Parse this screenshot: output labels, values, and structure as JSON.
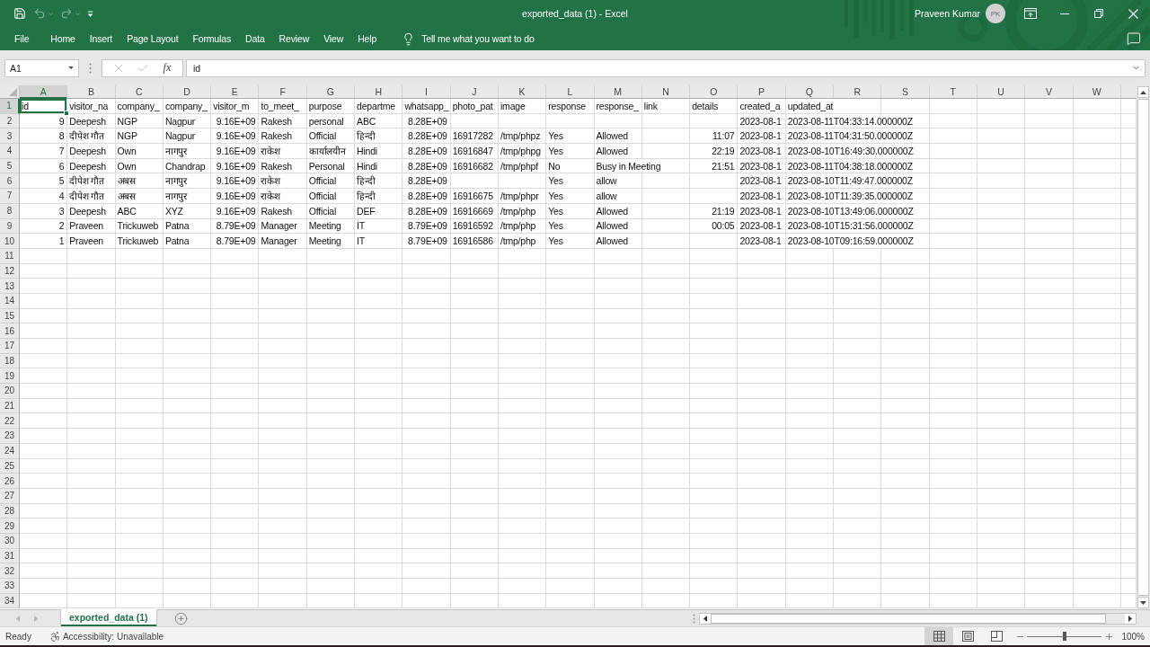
{
  "window": {
    "title": "exported_data (1) - Excel",
    "user_name": "Praveen Kumar",
    "avatar_initials": "PK"
  },
  "quick_access": [
    {
      "kind": "save",
      "disabled": false
    },
    {
      "kind": "undo",
      "disabled": true
    },
    {
      "kind": "redo",
      "disabled": true
    }
  ],
  "ribbon_tabs": [
    "File",
    "Home",
    "Insert",
    "Page Layout",
    "Formulas",
    "Data",
    "Review",
    "View",
    "Help"
  ],
  "tell_me": "Tell me what you want to do",
  "formula_bar": {
    "name_box": "A1",
    "function_button": "fx",
    "value": "id",
    "edit_buttons_disabled": true
  },
  "sheet": {
    "columns": [
      {
        "letter": "A",
        "selected": true
      },
      {
        "letter": "B",
        "selected": false
      },
      {
        "letter": "C",
        "selected": false
      },
      {
        "letter": "D",
        "selected": false
      },
      {
        "letter": "E",
        "selected": false
      },
      {
        "letter": "F",
        "selected": false
      },
      {
        "letter": "G",
        "selected": false
      },
      {
        "letter": "H",
        "selected": false
      },
      {
        "letter": "I",
        "selected": false
      },
      {
        "letter": "J",
        "selected": false
      },
      {
        "letter": "K",
        "selected": false
      },
      {
        "letter": "L",
        "selected": false
      },
      {
        "letter": "M",
        "selected": false
      },
      {
        "letter": "N",
        "selected": false
      },
      {
        "letter": "O",
        "selected": false
      },
      {
        "letter": "P",
        "selected": false
      },
      {
        "letter": "Q",
        "selected": false
      },
      {
        "letter": "R",
        "selected": false
      },
      {
        "letter": "S",
        "selected": false
      },
      {
        "letter": "T",
        "selected": false
      },
      {
        "letter": "U",
        "selected": false
      },
      {
        "letter": "V",
        "selected": false
      },
      {
        "letter": "W",
        "selected": false
      }
    ],
    "rows": [
      {
        "number": "1",
        "selected": true,
        "cells": [
          {
            "kind": "text",
            "text": "id"
          },
          {
            "kind": "text",
            "text": "visitor_na"
          },
          {
            "kind": "text",
            "text": "company_"
          },
          {
            "kind": "text",
            "text": "company_"
          },
          {
            "kind": "text",
            "text": "visitor_m"
          },
          {
            "kind": "text",
            "text": "to_meet_"
          },
          {
            "kind": "text",
            "text": "purpose"
          },
          {
            "kind": "text",
            "text": "departme"
          },
          {
            "kind": "text",
            "text": "whatsapp_"
          },
          {
            "kind": "text",
            "text": "photo_pat"
          },
          {
            "kind": "text",
            "text": "image"
          },
          {
            "kind": "text",
            "text": "response"
          },
          {
            "kind": "text",
            "text": "response_"
          },
          {
            "kind": "text",
            "text": "link"
          },
          {
            "kind": "text",
            "text": "details"
          },
          {
            "kind": "text",
            "text": "created_a"
          },
          {
            "kind": "text",
            "text": "updated_at"
          }
        ]
      },
      {
        "number": "2",
        "selected": false,
        "cells": [
          {
            "kind": "number",
            "text": "9"
          },
          {
            "kind": "text",
            "text": "Deepesh"
          },
          {
            "kind": "text",
            "text": "NGP"
          },
          {
            "kind": "text",
            "text": "Nagpur"
          },
          {
            "kind": "number",
            "text": "9.16E+09"
          },
          {
            "kind": "text",
            "text": "Rakesh"
          },
          {
            "kind": "text",
            "text": "personal"
          },
          {
            "kind": "text",
            "text": "ABC"
          },
          {
            "kind": "number",
            "text": "8.28E+09"
          },
          {
            "kind": "empty"
          },
          {
            "kind": "empty"
          },
          {
            "kind": "empty"
          },
          {
            "kind": "empty"
          },
          {
            "kind": "empty"
          },
          {
            "kind": "empty"
          },
          {
            "kind": "text",
            "text": "2023-08-1"
          },
          {
            "kind": "text",
            "text": "2023-08-11T04:33:14.000000Z"
          }
        ]
      },
      {
        "number": "3",
        "selected": false,
        "cells": [
          {
            "kind": "number",
            "text": "8"
          },
          {
            "kind": "text",
            "text": "दीपेश गौत"
          },
          {
            "kind": "text",
            "text": "NGP"
          },
          {
            "kind": "text",
            "text": "Nagpur"
          },
          {
            "kind": "number",
            "text": "9.16E+09"
          },
          {
            "kind": "text",
            "text": "Rakesh"
          },
          {
            "kind": "text",
            "text": "Official"
          },
          {
            "kind": "text",
            "text": "हिन्दी"
          },
          {
            "kind": "number",
            "text": "8.28E+09"
          },
          {
            "kind": "text",
            "text": "16917282"
          },
          {
            "kind": "text",
            "text": "/tmp/phpz"
          },
          {
            "kind": "text",
            "text": "Yes"
          },
          {
            "kind": "text",
            "text": "Allowed"
          },
          {
            "kind": "empty"
          },
          {
            "kind": "number",
            "text": "11:07"
          },
          {
            "kind": "text",
            "text": "2023-08-1"
          },
          {
            "kind": "text",
            "text": "2023-08-11T04:31:50.000000Z"
          }
        ]
      },
      {
        "number": "4",
        "selected": false,
        "cells": [
          {
            "kind": "number",
            "text": "7"
          },
          {
            "kind": "text",
            "text": "Deepesh"
          },
          {
            "kind": "text",
            "text": "Own"
          },
          {
            "kind": "text",
            "text": "नागपुर"
          },
          {
            "kind": "number",
            "text": "9.16E+09"
          },
          {
            "kind": "text",
            "text": "राकेश"
          },
          {
            "kind": "text",
            "text": "कार्यालयीन"
          },
          {
            "kind": "text",
            "text": "Hindi"
          },
          {
            "kind": "number",
            "text": "8.28E+09"
          },
          {
            "kind": "text",
            "text": "16916847"
          },
          {
            "kind": "text",
            "text": "/tmp/phpg"
          },
          {
            "kind": "text",
            "text": "Yes"
          },
          {
            "kind": "text",
            "text": "Allowed"
          },
          {
            "kind": "empty"
          },
          {
            "kind": "number",
            "text": "22:19"
          },
          {
            "kind": "text",
            "text": "2023-08-1"
          },
          {
            "kind": "text",
            "text": "2023-08-10T16:49:30.000000Z"
          }
        ]
      },
      {
        "number": "5",
        "selected": false,
        "cells": [
          {
            "kind": "number",
            "text": "6"
          },
          {
            "kind": "text",
            "text": "Deepesh"
          },
          {
            "kind": "text",
            "text": "Own"
          },
          {
            "kind": "text",
            "text": "Chandrap"
          },
          {
            "kind": "number",
            "text": "9.16E+09"
          },
          {
            "kind": "text",
            "text": "Rakesh"
          },
          {
            "kind": "text",
            "text": "Personal"
          },
          {
            "kind": "text",
            "text": "Hindi"
          },
          {
            "kind": "number",
            "text": "8.28E+09"
          },
          {
            "kind": "text",
            "text": "16916682"
          },
          {
            "kind": "text",
            "text": "/tmp/phpf"
          },
          {
            "kind": "text",
            "text": "No"
          },
          {
            "kind": "text",
            "text": "Busy in Meeting"
          },
          {
            "kind": "empty"
          },
          {
            "kind": "number",
            "text": "21:51"
          },
          {
            "kind": "text",
            "text": "2023-08-1"
          },
          {
            "kind": "text",
            "text": "2023-08-11T04:38:18.000000Z"
          }
        ]
      },
      {
        "number": "6",
        "selected": false,
        "cells": [
          {
            "kind": "number",
            "text": "5"
          },
          {
            "kind": "text",
            "text": "दीपेश गौत"
          },
          {
            "kind": "text",
            "text": "अबस"
          },
          {
            "kind": "text",
            "text": "नागपुर"
          },
          {
            "kind": "number",
            "text": "9.16E+09"
          },
          {
            "kind": "text",
            "text": "राकेश"
          },
          {
            "kind": "text",
            "text": "Official"
          },
          {
            "kind": "text",
            "text": "हिन्दी"
          },
          {
            "kind": "number",
            "text": "8.28E+09"
          },
          {
            "kind": "empty"
          },
          {
            "kind": "empty"
          },
          {
            "kind": "text",
            "text": "Yes"
          },
          {
            "kind": "text",
            "text": "allow"
          },
          {
            "kind": "empty"
          },
          {
            "kind": "empty"
          },
          {
            "kind": "text",
            "text": "2023-08-1"
          },
          {
            "kind": "text",
            "text": "2023-08-10T11:49:47.000000Z"
          }
        ]
      },
      {
        "number": "7",
        "selected": false,
        "cells": [
          {
            "kind": "number",
            "text": "4"
          },
          {
            "kind": "text",
            "text": "दीपेश गौत"
          },
          {
            "kind": "text",
            "text": "अबस"
          },
          {
            "kind": "text",
            "text": "नागपुर"
          },
          {
            "kind": "number",
            "text": "9.16E+09"
          },
          {
            "kind": "text",
            "text": "राकेश"
          },
          {
            "kind": "text",
            "text": "Official"
          },
          {
            "kind": "text",
            "text": "हिन्दी"
          },
          {
            "kind": "number",
            "text": "8.28E+09"
          },
          {
            "kind": "text",
            "text": "16916675"
          },
          {
            "kind": "text",
            "text": "/tmp/phpr"
          },
          {
            "kind": "text",
            "text": "Yes"
          },
          {
            "kind": "text",
            "text": "allow"
          },
          {
            "kind": "empty"
          },
          {
            "kind": "empty"
          },
          {
            "kind": "text",
            "text": "2023-08-1"
          },
          {
            "kind": "text",
            "text": "2023-08-10T11:39:35.000000Z"
          }
        ]
      },
      {
        "number": "8",
        "selected": false,
        "cells": [
          {
            "kind": "number",
            "text": "3"
          },
          {
            "kind": "text",
            "text": "Deepesh"
          },
          {
            "kind": "text",
            "text": "ABC"
          },
          {
            "kind": "text",
            "text": "XYZ"
          },
          {
            "kind": "number",
            "text": "9.16E+09"
          },
          {
            "kind": "text",
            "text": "Rakesh"
          },
          {
            "kind": "text",
            "text": "Official"
          },
          {
            "kind": "text",
            "text": "DEF"
          },
          {
            "kind": "number",
            "text": "8.28E+09"
          },
          {
            "kind": "text",
            "text": "16916669"
          },
          {
            "kind": "text",
            "text": "/tmp/php"
          },
          {
            "kind": "text",
            "text": "Yes"
          },
          {
            "kind": "text",
            "text": "Allowed"
          },
          {
            "kind": "empty"
          },
          {
            "kind": "number",
            "text": "21:19"
          },
          {
            "kind": "text",
            "text": "2023-08-1"
          },
          {
            "kind": "text",
            "text": "2023-08-10T13:49:06.000000Z"
          }
        ]
      },
      {
        "number": "9",
        "selected": false,
        "cells": [
          {
            "kind": "number",
            "text": "2"
          },
          {
            "kind": "text",
            "text": "Praveen"
          },
          {
            "kind": "text",
            "text": "Trickuweb"
          },
          {
            "kind": "text",
            "text": "Patna"
          },
          {
            "kind": "number",
            "text": "8.79E+09"
          },
          {
            "kind": "text",
            "text": "Manager"
          },
          {
            "kind": "text",
            "text": "Meeting"
          },
          {
            "kind": "text",
            "text": "IT"
          },
          {
            "kind": "number",
            "text": "8.79E+09"
          },
          {
            "kind": "text",
            "text": "16916592"
          },
          {
            "kind": "text",
            "text": "/tmp/php"
          },
          {
            "kind": "text",
            "text": "Yes"
          },
          {
            "kind": "text",
            "text": "Allowed"
          },
          {
            "kind": "empty"
          },
          {
            "kind": "number",
            "text": "00:05"
          },
          {
            "kind": "text",
            "text": "2023-08-1"
          },
          {
            "kind": "text",
            "text": "2023-08-10T15:31:56.000000Z"
          }
        ]
      },
      {
        "number": "10",
        "selected": false,
        "cells": [
          {
            "kind": "number",
            "text": "1"
          },
          {
            "kind": "text",
            "text": "Praveen"
          },
          {
            "kind": "text",
            "text": "Trickuweb"
          },
          {
            "kind": "text",
            "text": "Patna"
          },
          {
            "kind": "number",
            "text": "8.79E+09"
          },
          {
            "kind": "text",
            "text": "Manager"
          },
          {
            "kind": "text",
            "text": "Meeting"
          },
          {
            "kind": "text",
            "text": "IT"
          },
          {
            "kind": "number",
            "text": "8.79E+09"
          },
          {
            "kind": "text",
            "text": "16916586"
          },
          {
            "kind": "text",
            "text": "/tmp/php"
          },
          {
            "kind": "text",
            "text": "Yes"
          },
          {
            "kind": "text",
            "text": "Allowed"
          },
          {
            "kind": "empty"
          },
          {
            "kind": "empty"
          },
          {
            "kind": "text",
            "text": "2023-08-1"
          },
          {
            "kind": "text",
            "text": "2023-08-10T09:16:59.000000Z"
          }
        ]
      },
      {
        "number": "11",
        "selected": false
      },
      {
        "number": "12",
        "selected": false
      },
      {
        "number": "13",
        "selected": false
      },
      {
        "number": "14",
        "selected": false
      },
      {
        "number": "15",
        "selected": false
      },
      {
        "number": "16",
        "selected": false
      },
      {
        "number": "17",
        "selected": false
      },
      {
        "number": "18",
        "selected": false
      },
      {
        "number": "19",
        "selected": false
      },
      {
        "number": "20",
        "selected": false
      },
      {
        "number": "21",
        "selected": false
      },
      {
        "number": "22",
        "selected": false
      },
      {
        "number": "23",
        "selected": false
      },
      {
        "number": "24",
        "selected": false
      },
      {
        "number": "25",
        "selected": false
      },
      {
        "number": "26",
        "selected": false
      },
      {
        "number": "27",
        "selected": false
      },
      {
        "number": "28",
        "selected": false
      },
      {
        "number": "29",
        "selected": false
      },
      {
        "number": "30",
        "selected": false
      },
      {
        "number": "31",
        "selected": false
      },
      {
        "number": "32",
        "selected": false
      },
      {
        "number": "33",
        "selected": false
      },
      {
        "number": "34",
        "selected": false
      }
    ]
  },
  "sheet_tabs": [
    {
      "label": "exported_data (1)",
      "selected": true
    }
  ],
  "status_bar": {
    "mode": "Ready",
    "accessibility": "Accessibility: Unavailable",
    "views": [
      {
        "kind": "normal",
        "selected": true
      },
      {
        "kind": "page_layout",
        "selected": false
      },
      {
        "kind": "page_break",
        "selected": false
      }
    ],
    "zoom": {
      "level": 0.5,
      "label": "100%"
    }
  }
}
